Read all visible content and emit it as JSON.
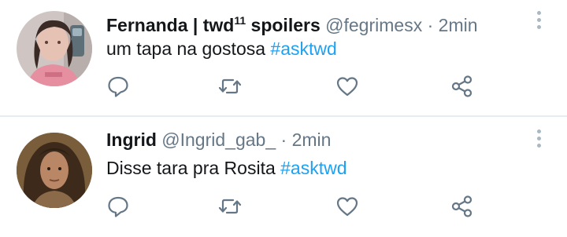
{
  "tweets": [
    {
      "name": "Fernanda | twd",
      "name_sup": "11",
      "name_suffix": " spoilers",
      "handle": "@fegrimesx",
      "separator": "·",
      "time": "2min",
      "text": "um tapa na gostosa",
      "hashtag": "#asktwd"
    },
    {
      "name": "Ingrid",
      "handle": "@Ingrid_gab_",
      "separator": "·",
      "time": "2min",
      "text": "Disse tara pra Rosita",
      "hashtag": "#asktwd"
    }
  ],
  "icons": {
    "reply": "reply-icon",
    "retweet": "retweet-icon",
    "like": "heart-icon",
    "share": "share-icon",
    "more": "more-vertical-icon"
  },
  "colors": {
    "hashtag": "#1da1f2",
    "secondary_text": "#657786",
    "icon": "#657786",
    "divider": "#e6ecf0"
  }
}
